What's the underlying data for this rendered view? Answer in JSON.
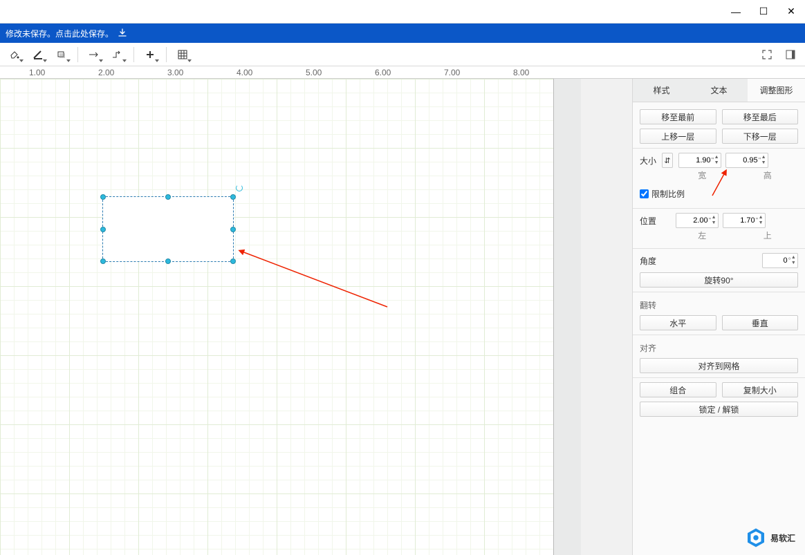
{
  "titlebar": {
    "minimize": "—",
    "maximize": "☐",
    "close": "✕"
  },
  "save_bar": {
    "text": "修改未保存。点击此处保存。"
  },
  "ruler": {
    "marks": [
      "1.00",
      "2.00",
      "3.00",
      "4.00",
      "5.00",
      "6.00",
      "7.00",
      "8.00"
    ]
  },
  "panel": {
    "tabs": {
      "style": "样式",
      "text": "文本",
      "adjust": "调整图形"
    },
    "arrange": {
      "bring_front": "移至最前",
      "send_back": "移至最后",
      "up_one": "上移一层",
      "down_one": "下移一层"
    },
    "size": {
      "label": "大小",
      "width": "1.90",
      "height": "0.95",
      "width_unit": "\"",
      "height_unit": "\"",
      "sub_w": "宽",
      "sub_h": "高",
      "constrain_checked": true,
      "constrain_label": "限制比例"
    },
    "position": {
      "label": "位置",
      "left": "2.00",
      "top": "1.70",
      "unit": "\"",
      "sub_left": "左",
      "sub_top": "上"
    },
    "angle": {
      "label": "角度",
      "value": "0",
      "unit": "°",
      "rotate90": "旋转90°"
    },
    "flip": {
      "label": "翻转",
      "h": "水平",
      "v": "垂直"
    },
    "align": {
      "label": "对齐",
      "snap_grid": "对齐到网格"
    },
    "group": {
      "group": "组合",
      "copy_size": "复制大小",
      "lock": "锁定 / 解锁"
    }
  },
  "watermark": "易软汇"
}
